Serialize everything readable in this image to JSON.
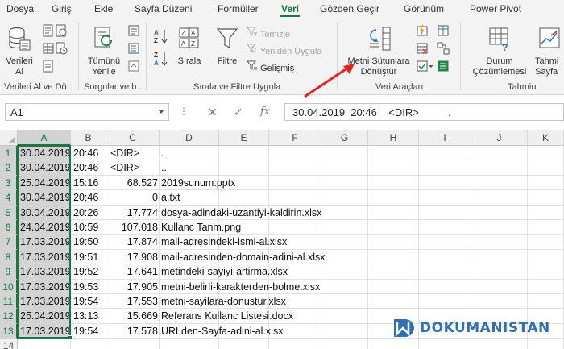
{
  "menu": {
    "tabs": [
      "Dosya",
      "Giriş",
      "Ekle",
      "Sayfa Düzeni",
      "Formüller",
      "Veri",
      "Gözden Geçir",
      "Görünüm",
      "Power Pivot"
    ],
    "active": "Veri"
  },
  "ribbon": {
    "get_data": {
      "label1": "Verileri",
      "label2": "Al"
    },
    "refresh_all": {
      "label1": "Tümünü",
      "label2": "Yenile"
    },
    "sort": {
      "label": "Sırala"
    },
    "filter": {
      "label": "Filtre"
    },
    "clear": {
      "label": "Temizle"
    },
    "reapply": {
      "label": "Yeniden Uygula"
    },
    "advanced": {
      "label": "Gelişmiş"
    },
    "text_to_columns": {
      "label1": "Metni Sütunlara",
      "label2": "Dönüştür"
    },
    "forecast_whatif": {
      "label1": "Durum",
      "label2": "Çözümlemesi"
    },
    "forecast_sheet": {
      "label1": "Tahmi",
      "label2": "Sayfa"
    },
    "groups": {
      "get_transform": "Verileri Al ve Dö...",
      "queries": "Sorgular ve b...",
      "sort_filter": "Sırala ve Filtre Uygula",
      "data_tools": "Veri Araçları",
      "forecast": "Tahmin"
    }
  },
  "formula_bar": {
    "name_box": "A1",
    "cancel": "✕",
    "enter": "✓",
    "fx": "fx",
    "formula": "30.04.2019  20:46    <DIR>          ."
  },
  "grid": {
    "columns": [
      "A",
      "B",
      "C",
      "D",
      "E",
      "F",
      "G",
      "H",
      "I",
      "J",
      "K"
    ],
    "rows": [
      {
        "n": "1",
        "a": "30.04.2019",
        "b": "20:46",
        "c": "<DIR>",
        "c_right": "",
        "d": "."
      },
      {
        "n": "2",
        "a": "30.04.2019",
        "b": "20:46",
        "c": "<DIR>",
        "c_right": "",
        "d": ".."
      },
      {
        "n": "3",
        "a": "25.04.2019",
        "b": "15:16",
        "c": "",
        "c_right": "68.527",
        "d": "2019sunum.pptx"
      },
      {
        "n": "4",
        "a": "30.04.2019",
        "b": "20:46",
        "c": "",
        "c_right": "0",
        "d": "a.txt"
      },
      {
        "n": "5",
        "a": "30.04.2019",
        "b": "20:26",
        "c": "",
        "c_right": "17.774",
        "d": "dosya-adindaki-uzantiyi-kaldirin.xlsx"
      },
      {
        "n": "6",
        "a": "24.04.2019",
        "b": "10:59",
        "c": "",
        "c_right": "107.018",
        "d": "Kullanc Tanm.png"
      },
      {
        "n": "7",
        "a": "17.03.2019",
        "b": "19:50",
        "c": "",
        "c_right": "17.874",
        "d": "mail-adresindeki-ismi-al.xlsx"
      },
      {
        "n": "8",
        "a": "17.03.2019",
        "b": "19:51",
        "c": "",
        "c_right": "17.908",
        "d": "mail-adresinden-domain-adini-al.xlsx"
      },
      {
        "n": "9",
        "a": "17.03.2019",
        "b": "19:52",
        "c": "",
        "c_right": "17.641",
        "d": "metindeki-sayiyi-artirma.xlsx"
      },
      {
        "n": "10",
        "a": "17.03.2019",
        "b": "19:53",
        "c": "",
        "c_right": "17.905",
        "d": "metni-belirli-karakterden-bolme.xlsx"
      },
      {
        "n": "11",
        "a": "17.03.2019",
        "b": "19:54",
        "c": "",
        "c_right": "17.553",
        "d": "metni-sayilara-donustur.xlsx"
      },
      {
        "n": "12",
        "a": "25.04.2019",
        "b": "13:13",
        "c": "",
        "c_right": "15.669",
        "d": "Referans Kullanc Listesi.docx"
      },
      {
        "n": "13",
        "a": "17.03.2019",
        "b": "19:54",
        "c": "",
        "c_right": "17.578",
        "d": "URLden-Sayfa-adini-al.xlsx"
      },
      {
        "n": "14",
        "a": "",
        "b": "",
        "c": "",
        "c_right": "",
        "d": ""
      }
    ]
  },
  "watermark": {
    "text": "DOKUMANISTAN"
  },
  "colors": {
    "accent": "#107c41",
    "arrow": "#e8231c",
    "watermark": "#2e6fb5"
  }
}
